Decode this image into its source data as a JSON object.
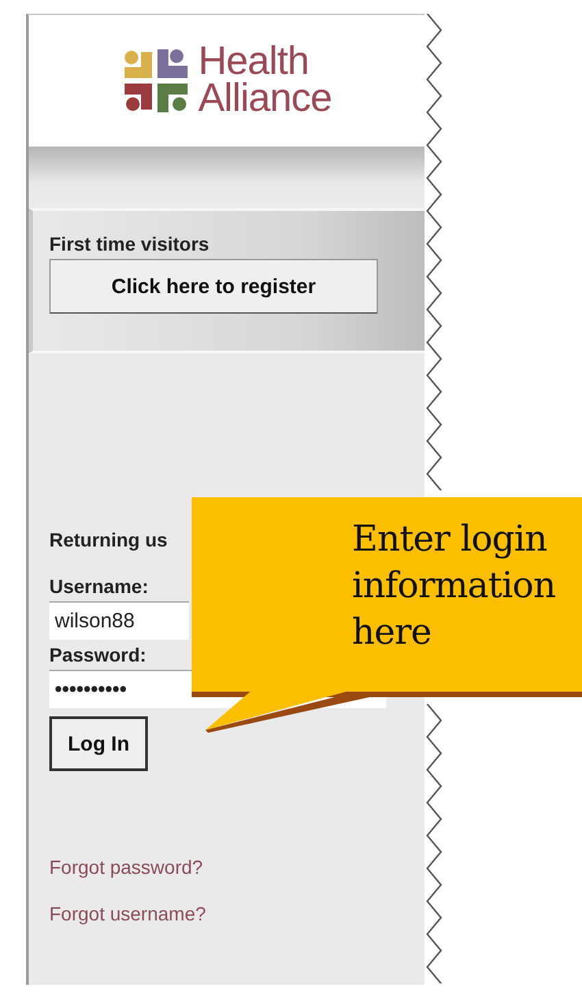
{
  "logo": {
    "line_1": "Health",
    "line_2": "Alliance"
  },
  "register": {
    "heading": "First time visitors",
    "button": "Click here to register"
  },
  "login": {
    "heading": "Returning us",
    "username_label": "Username:",
    "username_value": "wilson88",
    "password_label": "Password:",
    "password_mask": "••••••••••",
    "button": "Log In"
  },
  "links": [
    "Forgot password?",
    "Forgot username?"
  ],
  "callout": {
    "text": "Enter login information here"
  }
}
